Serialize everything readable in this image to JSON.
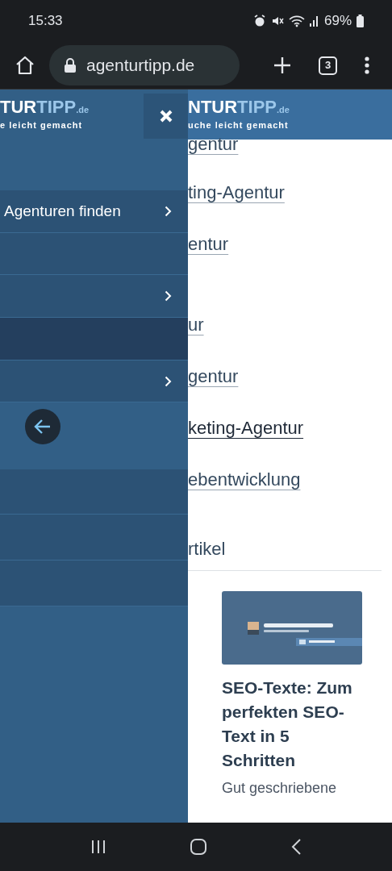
{
  "status_bar": {
    "time": "15:33",
    "battery": "69%"
  },
  "browser": {
    "url": "agenturtipp.de",
    "tab_count": "3"
  },
  "drawer": {
    "logo": {
      "brand_dark": "TUR",
      "brand_light": "TIPP",
      "suffix": ".de",
      "tagline": "e leicht gemacht"
    },
    "items": [
      {
        "kind": "spacer"
      },
      {
        "kind": "item",
        "label": "Agenturen finden",
        "submenu": true,
        "selected": false
      },
      {
        "kind": "item",
        "submenu": false,
        "selected": false
      },
      {
        "kind": "item",
        "submenu": true,
        "selected": false
      },
      {
        "kind": "item",
        "submenu": false,
        "selected": true
      },
      {
        "kind": "item",
        "submenu": true,
        "selected": false
      },
      {
        "kind": "back"
      },
      {
        "kind": "item",
        "submenu": false,
        "selected": false
      },
      {
        "kind": "item",
        "submenu": false,
        "selected": false
      },
      {
        "kind": "item",
        "submenu": false,
        "selected": false
      }
    ]
  },
  "header": {
    "logo": {
      "brand_dark": "NTUR",
      "brand_light": "TIPP",
      "suffix": ".de",
      "tagline": "uche leicht gemacht"
    }
  },
  "content": {
    "links": [
      {
        "text": "gentur",
        "active": false
      },
      {
        "text": "ting-Agentur",
        "active": false
      },
      {
        "text": "entur",
        "active": false
      },
      {
        "text": "ur",
        "active": false
      },
      {
        "text": "gentur",
        "active": false
      },
      {
        "text": "keting-Agentur",
        "active": true
      },
      {
        "text": "ebentwicklung",
        "active": false
      }
    ],
    "section_title": "rtikel",
    "article": {
      "kind": "picture",
      "title": "SEO-Texte: Zum perfekten SEO-Text in 5 Schritten",
      "excerpt": "Gut geschriebene"
    }
  }
}
